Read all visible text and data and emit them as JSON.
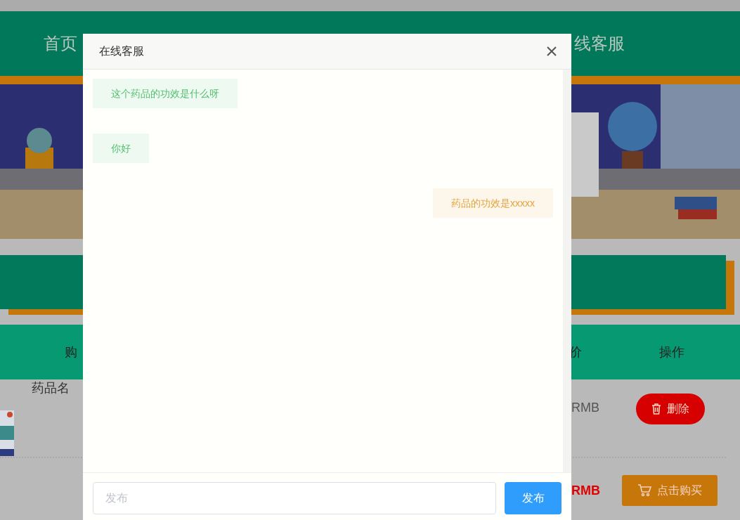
{
  "page": {
    "nav": {
      "items": [
        "首页",
        "线客服"
      ]
    },
    "table": {
      "columns": [
        "购",
        "价",
        "操作"
      ],
      "rows": [
        {
          "name": "药品名",
          "price": "RMB",
          "highlight": false,
          "action": {
            "kind": "delete",
            "label": "删除"
          }
        },
        {
          "price": "RMB",
          "highlight": true,
          "action": {
            "kind": "buy",
            "label": "点击购买"
          }
        }
      ]
    }
  },
  "dialog": {
    "title": "在线客服",
    "messages": [
      {
        "outgoing": false,
        "text": "这个药品的功效是什么呀"
      },
      {
        "outgoing": false,
        "text": "你好"
      },
      {
        "outgoing": true,
        "text": "药品的功效是xxxxx"
      }
    ],
    "input": {
      "placeholder": "发布"
    },
    "send_button": "发布"
  }
}
